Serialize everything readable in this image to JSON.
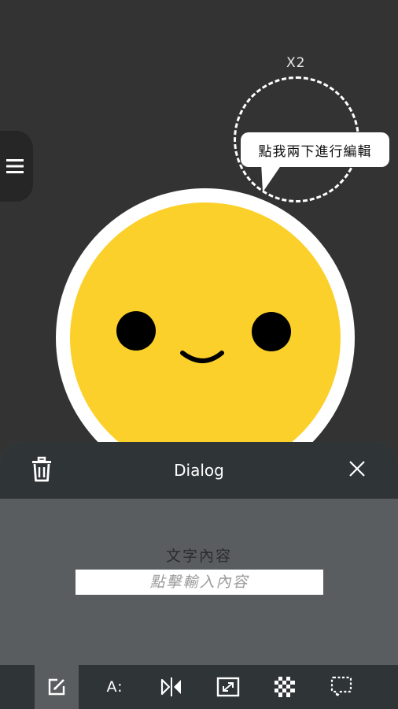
{
  "canvas": {
    "double_tap_hint": "X2",
    "speech_bubble_text": "點我兩下進行編輯",
    "sticker": {
      "type": "smiley-face",
      "fill": "#fcd02a",
      "outline": "#ffffff",
      "features": "#000000"
    }
  },
  "side_menu": {
    "icon": "hamburger-menu-icon"
  },
  "dialog": {
    "title": "Dialog",
    "delete_icon": "trash-icon",
    "close_icon": "close-icon",
    "content_label": "文字內容",
    "text_input": {
      "value": "",
      "placeholder": "點擊輸入內容"
    }
  },
  "toolbar": {
    "items": [
      {
        "icon": "edit-text-icon",
        "active": true
      },
      {
        "icon": "font-style-icon",
        "label": "A:",
        "active": false
      },
      {
        "icon": "flip-horizontal-icon",
        "active": false
      },
      {
        "icon": "resize-icon",
        "active": false
      },
      {
        "icon": "transparency-icon",
        "active": false
      },
      {
        "icon": "bubble-shape-icon",
        "active": false
      }
    ]
  },
  "colors": {
    "background": "#333333",
    "panel_header": "#2f3436",
    "panel_body": "#5a5d60",
    "smiley_yellow": "#fcd02a"
  }
}
